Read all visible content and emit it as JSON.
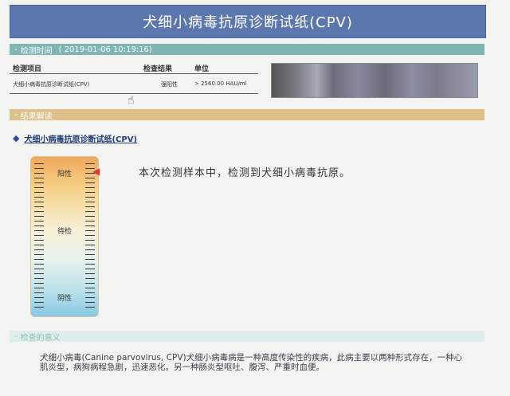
{
  "header": {
    "title": "犬细小病毒抗原诊断试纸(CPV)"
  },
  "time_section": {
    "dash": "-",
    "label": "检测时间",
    "value": "( 2019-01-06 10:19:16)"
  },
  "table": {
    "headers": [
      "检测项目",
      "检查结果",
      "单位"
    ],
    "rows": [
      {
        "item": "犬细小病毒抗原诊断试纸(CPV)",
        "result": "强阳性",
        "unit": "> 2560.00 HAU/ml"
      }
    ]
  },
  "result_section": {
    "dash": "-",
    "label": "结果解读"
  },
  "test": {
    "title": "犬细小病毒抗原诊断试纸(CPV)",
    "strip_labels": {
      "positive": "阳性",
      "pending": "待检",
      "negative": "阴性"
    },
    "interpretation": "本次检测样本中，检测到犬细小病毒抗原。"
  },
  "meaning_section": {
    "dash": "-",
    "label": "检查的意义",
    "text": "犬细小病毒(Canine parvovirus, CPV)犬细小病毒病是一种高度传染性的疾病，此病主要以两种形式存在，一种心肌炎型，病狗病程急剧，迅速恶化。另一种肠炎型呕吐、腹泻、严重时血便。"
  },
  "icons": {
    "cursor": "hand-cursor-icon",
    "diamond": "diamond-bullet-icon",
    "arrow": "pointer-arrow-icon"
  }
}
